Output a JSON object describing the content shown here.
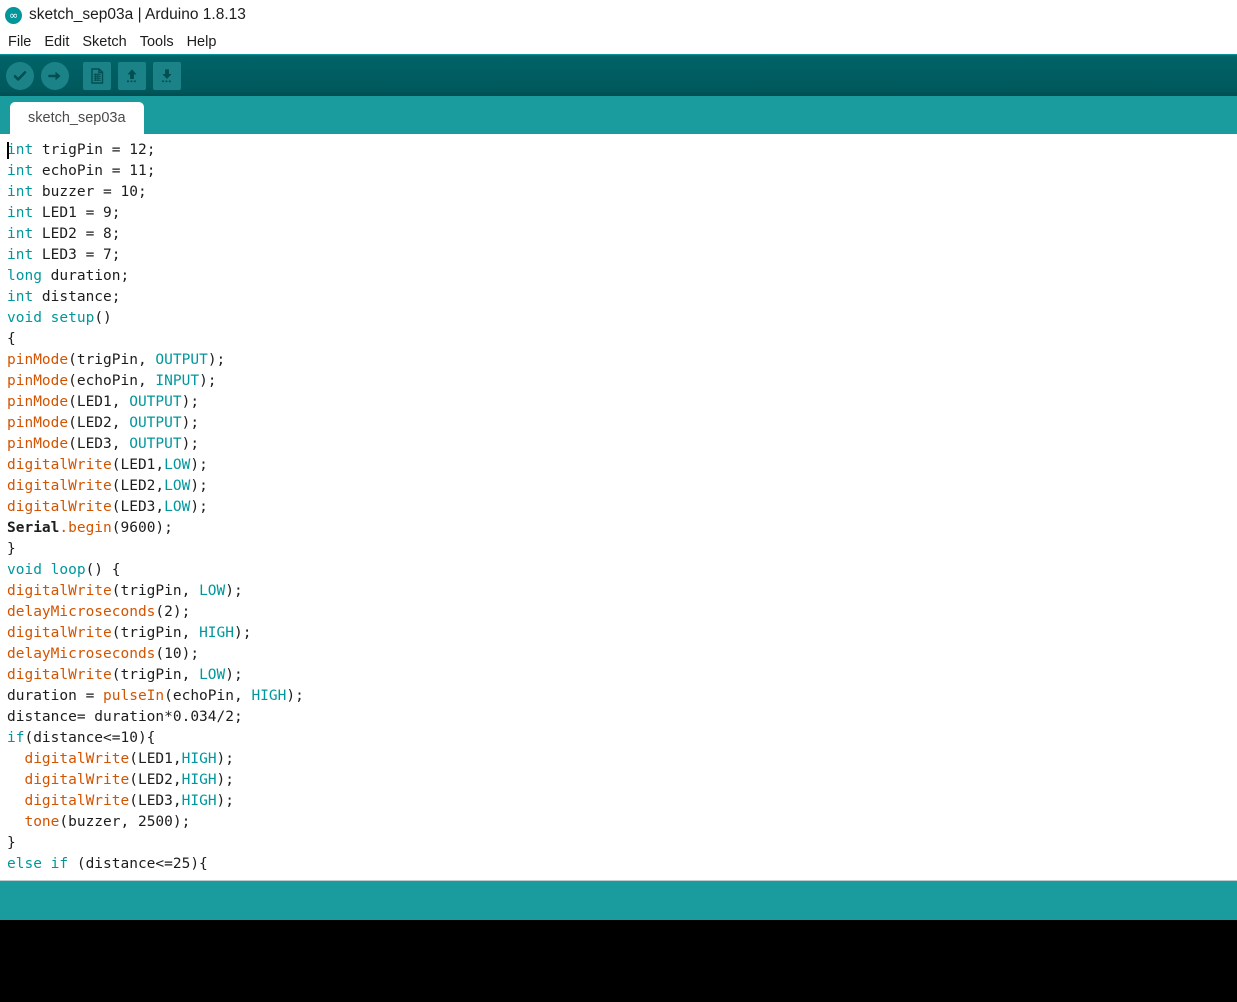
{
  "window": {
    "title": "sketch_sep03a | Arduino 1.8.13",
    "logo_icon": "arduino-infinity-icon",
    "logo_glyph": "∞"
  },
  "menu": {
    "items": [
      {
        "label": "File"
      },
      {
        "label": "Edit"
      },
      {
        "label": "Sketch"
      },
      {
        "label": "Tools"
      },
      {
        "label": "Help"
      }
    ]
  },
  "toolbar": {
    "buttons": [
      {
        "name": "verify-button",
        "icon": "checkmark-icon",
        "label": "Verify"
      },
      {
        "name": "upload-button",
        "icon": "right-arrow-icon",
        "label": "Upload"
      },
      {
        "name": "new-button",
        "icon": "new-document-icon",
        "label": "New"
      },
      {
        "name": "open-button",
        "icon": "up-arrow-icon",
        "label": "Open"
      },
      {
        "name": "save-button",
        "icon": "down-arrow-icon",
        "label": "Save"
      }
    ]
  },
  "tabs": {
    "active_index": 0,
    "items": [
      {
        "label": "sketch_sep03a"
      }
    ]
  },
  "editor": {
    "caret_line": 1,
    "caret_column": 1,
    "lines": [
      [
        {
          "t": "int",
          "c": "kw"
        },
        {
          "t": " trigPin = 12;",
          "c": "pl"
        }
      ],
      [
        {
          "t": "int",
          "c": "kw"
        },
        {
          "t": " echoPin = 11;",
          "c": "pl"
        }
      ],
      [
        {
          "t": "int",
          "c": "kw"
        },
        {
          "t": " buzzer = 10;",
          "c": "pl"
        }
      ],
      [
        {
          "t": "int",
          "c": "kw"
        },
        {
          "t": " LED1 = 9;",
          "c": "pl"
        }
      ],
      [
        {
          "t": "int",
          "c": "kw"
        },
        {
          "t": " LED2 = 8;",
          "c": "pl"
        }
      ],
      [
        {
          "t": "int",
          "c": "kw"
        },
        {
          "t": " LED3 = 7;",
          "c": "pl"
        }
      ],
      [
        {
          "t": "long",
          "c": "kw"
        },
        {
          "t": " duration;",
          "c": "pl"
        }
      ],
      [
        {
          "t": "int",
          "c": "kw"
        },
        {
          "t": " distance;",
          "c": "pl"
        }
      ],
      [
        {
          "t": "void setup",
          "c": "kw"
        },
        {
          "t": "()",
          "c": "pl"
        }
      ],
      [
        {
          "t": "{",
          "c": "pl"
        }
      ],
      [
        {
          "t": "pinMode",
          "c": "fn"
        },
        {
          "t": "(trigPin, ",
          "c": "pl"
        },
        {
          "t": "OUTPUT",
          "c": "cst"
        },
        {
          "t": ");",
          "c": "pl"
        }
      ],
      [
        {
          "t": "pinMode",
          "c": "fn"
        },
        {
          "t": "(echoPin, ",
          "c": "pl"
        },
        {
          "t": "INPUT",
          "c": "cst"
        },
        {
          "t": ");",
          "c": "pl"
        }
      ],
      [
        {
          "t": "pinMode",
          "c": "fn"
        },
        {
          "t": "(LED1, ",
          "c": "pl"
        },
        {
          "t": "OUTPUT",
          "c": "cst"
        },
        {
          "t": ");",
          "c": "pl"
        }
      ],
      [
        {
          "t": "pinMode",
          "c": "fn"
        },
        {
          "t": "(LED2, ",
          "c": "pl"
        },
        {
          "t": "OUTPUT",
          "c": "cst"
        },
        {
          "t": ");",
          "c": "pl"
        }
      ],
      [
        {
          "t": "pinMode",
          "c": "fn"
        },
        {
          "t": "(LED3, ",
          "c": "pl"
        },
        {
          "t": "OUTPUT",
          "c": "cst"
        },
        {
          "t": ");",
          "c": "pl"
        }
      ],
      [
        {
          "t": "digitalWrite",
          "c": "fn"
        },
        {
          "t": "(LED1,",
          "c": "pl"
        },
        {
          "t": "LOW",
          "c": "cst"
        },
        {
          "t": ");",
          "c": "pl"
        }
      ],
      [
        {
          "t": "digitalWrite",
          "c": "fn"
        },
        {
          "t": "(LED2,",
          "c": "pl"
        },
        {
          "t": "LOW",
          "c": "cst"
        },
        {
          "t": ");",
          "c": "pl"
        }
      ],
      [
        {
          "t": "digitalWrite",
          "c": "fn"
        },
        {
          "t": "(LED3,",
          "c": "pl"
        },
        {
          "t": "LOW",
          "c": "cst"
        },
        {
          "t": ");",
          "c": "pl"
        }
      ],
      [
        {
          "t": "Serial",
          "c": "cls"
        },
        {
          "t": ".begin",
          "c": "fn"
        },
        {
          "t": "(9600);",
          "c": "pl"
        }
      ],
      [
        {
          "t": "}",
          "c": "pl"
        }
      ],
      [
        {
          "t": "void loop",
          "c": "kw"
        },
        {
          "t": "() {",
          "c": "pl"
        }
      ],
      [
        {
          "t": "digitalWrite",
          "c": "fn"
        },
        {
          "t": "(trigPin, ",
          "c": "pl"
        },
        {
          "t": "LOW",
          "c": "cst"
        },
        {
          "t": ");",
          "c": "pl"
        }
      ],
      [
        {
          "t": "delayMicroseconds",
          "c": "fn"
        },
        {
          "t": "(2);",
          "c": "pl"
        }
      ],
      [
        {
          "t": "digitalWrite",
          "c": "fn"
        },
        {
          "t": "(trigPin, ",
          "c": "pl"
        },
        {
          "t": "HIGH",
          "c": "cst"
        },
        {
          "t": ");",
          "c": "pl"
        }
      ],
      [
        {
          "t": "delayMicroseconds",
          "c": "fn"
        },
        {
          "t": "(10);",
          "c": "pl"
        }
      ],
      [
        {
          "t": "digitalWrite",
          "c": "fn"
        },
        {
          "t": "(trigPin, ",
          "c": "pl"
        },
        {
          "t": "LOW",
          "c": "cst"
        },
        {
          "t": ");",
          "c": "pl"
        }
      ],
      [
        {
          "t": "duration = ",
          "c": "pl"
        },
        {
          "t": "pulseIn",
          "c": "fn"
        },
        {
          "t": "(echoPin, ",
          "c": "pl"
        },
        {
          "t": "HIGH",
          "c": "cst"
        },
        {
          "t": ");",
          "c": "pl"
        }
      ],
      [
        {
          "t": "distance= duration*0.034/2;",
          "c": "pl"
        }
      ],
      [
        {
          "t": "if",
          "c": "kw"
        },
        {
          "t": "(distance<=10){",
          "c": "pl"
        }
      ],
      [
        {
          "t": "  ",
          "c": "pl"
        },
        {
          "t": "digitalWrite",
          "c": "fn"
        },
        {
          "t": "(LED1,",
          "c": "pl"
        },
        {
          "t": "HIGH",
          "c": "cst"
        },
        {
          "t": ");",
          "c": "pl"
        }
      ],
      [
        {
          "t": "  ",
          "c": "pl"
        },
        {
          "t": "digitalWrite",
          "c": "fn"
        },
        {
          "t": "(LED2,",
          "c": "pl"
        },
        {
          "t": "HIGH",
          "c": "cst"
        },
        {
          "t": ");",
          "c": "pl"
        }
      ],
      [
        {
          "t": "  ",
          "c": "pl"
        },
        {
          "t": "digitalWrite",
          "c": "fn"
        },
        {
          "t": "(LED3,",
          "c": "pl"
        },
        {
          "t": "HIGH",
          "c": "cst"
        },
        {
          "t": ");",
          "c": "pl"
        }
      ],
      [
        {
          "t": "  ",
          "c": "pl"
        },
        {
          "t": "tone",
          "c": "fn"
        },
        {
          "t": "(buzzer, 2500);",
          "c": "pl"
        }
      ],
      [
        {
          "t": "}",
          "c": "pl"
        }
      ],
      [
        {
          "t": "else if",
          "c": "kw"
        },
        {
          "t": " (distance<=25){",
          "c": "pl"
        }
      ]
    ]
  },
  "status_bar": {
    "message": ""
  },
  "console": {
    "text": ""
  },
  "colors": {
    "accent_teal": "#00979C",
    "toolbar_dark": "#006468",
    "tab_bar_teal": "#1a9b9e",
    "keyword": "#00979C",
    "function": "#D35400",
    "constant": "#00979C",
    "plain_text": "#1d1d1d",
    "console_bg": "#000000"
  }
}
